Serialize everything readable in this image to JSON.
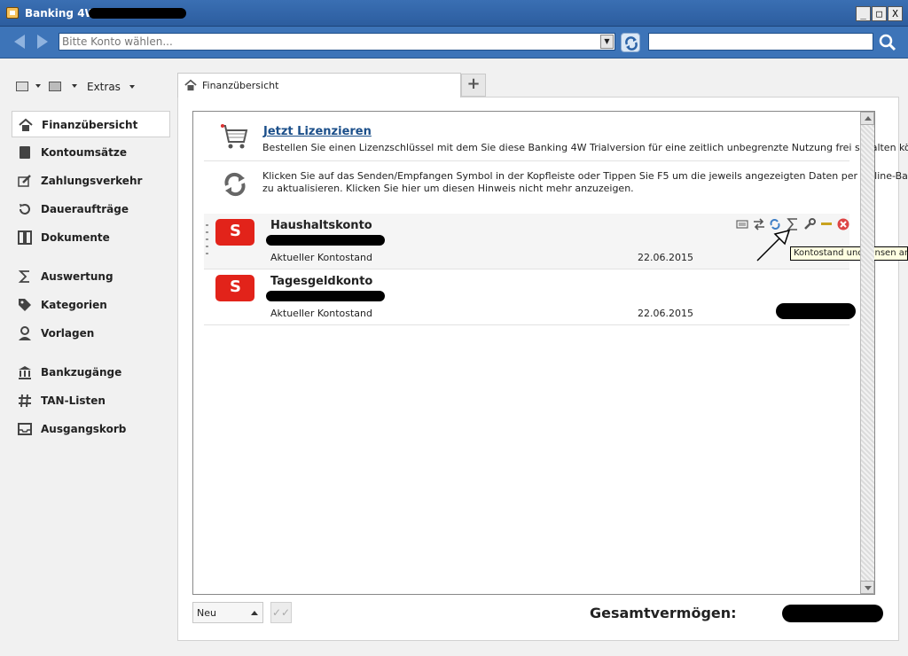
{
  "window": {
    "title": "Banking 4W",
    "buttons": [
      "_",
      "□",
      "X"
    ]
  },
  "addressbar": {
    "account_placeholder": "Bitte Konto wählen...",
    "search_value": ""
  },
  "toolbar": {
    "extras_label": "Extras"
  },
  "sidebar": {
    "items": [
      {
        "label": "Finanzübersicht",
        "icon": "home-icon"
      },
      {
        "label": "Kontoumsätze",
        "icon": "book-icon"
      },
      {
        "label": "Zahlungsverkehr",
        "icon": "edit-icon"
      },
      {
        "label": "Daueraufträge",
        "icon": "history-icon"
      },
      {
        "label": "Dokumente",
        "icon": "columns-icon"
      },
      {
        "label": "Auswertung",
        "icon": "sigma-icon"
      },
      {
        "label": "Kategorien",
        "icon": "tag-icon"
      },
      {
        "label": "Vorlagen",
        "icon": "user-icon"
      },
      {
        "label": "Bankzugänge",
        "icon": "bank-icon"
      },
      {
        "label": "TAN-Listen",
        "icon": "hash-icon"
      },
      {
        "label": "Ausgangskorb",
        "icon": "inbox-icon"
      }
    ]
  },
  "tabs": {
    "active_label": "Finanzübersicht",
    "add_label": "+"
  },
  "license": {
    "link": "Jetzt Lizenzieren",
    "text": "Bestellen Sie einen Lizenzschlüssel mit dem Sie diese Banking 4W Trialversion für eine zeitlich unbegrenzte Nutzung frei schalten können."
  },
  "sync_hint": {
    "line1": "Klicken Sie auf das Senden/Empfangen Symbol in der Kopfleiste oder Tippen Sie F5 um die jeweils angezeigten Daten per Online-Banking",
    "line2": "zu aktualisieren. Klicken Sie hier um diesen Hinweis nicht mehr anzuzeigen."
  },
  "accounts": [
    {
      "name": "Haushaltskonto",
      "subtitle": "Aktueller Kontostand",
      "date": "22.06.2015"
    },
    {
      "name": "Tagesgeldkonto",
      "subtitle": "Aktueller Kontostand",
      "date": "22.06.2015"
    }
  ],
  "bank_logo_letter": "S",
  "tooltip": "Kontostand und Zinsen anz",
  "footer": {
    "new_label": "Neu",
    "total_label": "Gesamtvermögen:"
  },
  "colors": {
    "titlebar": "#2c5d9f",
    "sparkasse_red": "#e2231a",
    "link": "#1b4f8a"
  }
}
